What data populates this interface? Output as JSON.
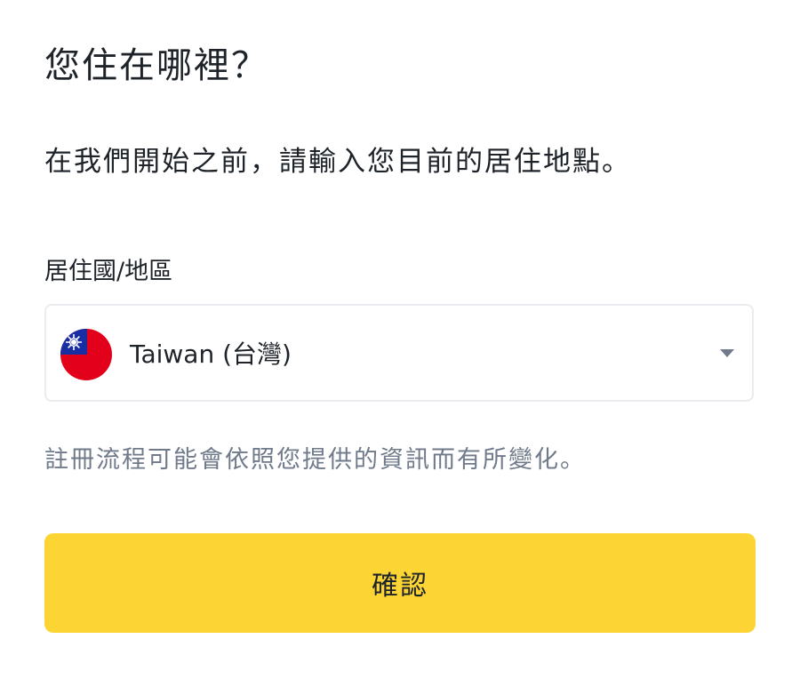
{
  "header": {
    "title": "您住在哪裡？",
    "subtitle": "在我們開始之前，請輸入您目前的居住地點。"
  },
  "residence": {
    "label": "居住國/地區",
    "selected": "Taiwan (台灣)",
    "flag_icon": "taiwan-flag-icon",
    "caret_icon": "caret-down-icon"
  },
  "helper_text": "註冊流程可能會依照您提供的資訊而有所變化。",
  "confirm_button": {
    "label": "確認"
  },
  "colors": {
    "primary": "#FCD535",
    "text": "#1E2329",
    "muted": "#707A8A",
    "border": "#EAECEF",
    "flag_red": "#E3001B",
    "flag_blue": "#1A2EA3"
  }
}
